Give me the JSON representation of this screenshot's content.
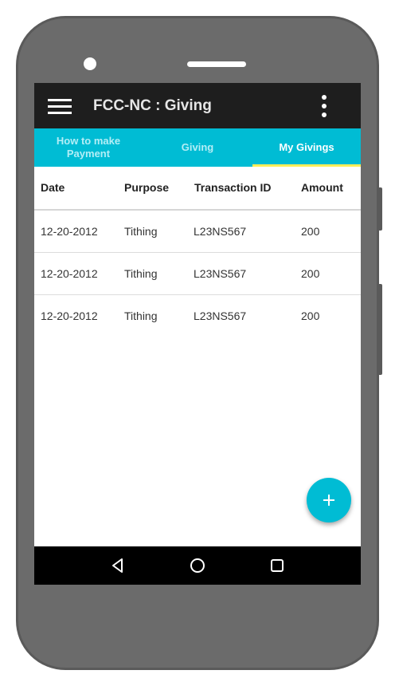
{
  "toolbar": {
    "title": "FCC-NC : Giving",
    "menu_icon": "hamburger-menu-icon",
    "overflow_icon": "more-vert-icon"
  },
  "tabs": [
    {
      "label_line1": "How to make",
      "label_line2": "Payment",
      "active": false
    },
    {
      "label": "Giving",
      "active": false
    },
    {
      "label": "My Givings",
      "active": true
    }
  ],
  "table": {
    "columns": [
      "Date",
      "Purpose",
      "Transaction ID",
      "Amount"
    ],
    "rows": [
      [
        "12-20-2012",
        "Tithing",
        "L23NS567",
        "200"
      ],
      [
        "12-20-2012",
        "Tithing",
        "L23NS567",
        "200"
      ],
      [
        "12-20-2012",
        "Tithing",
        "L23NS567",
        "200"
      ]
    ]
  },
  "fab": {
    "icon": "plus-icon"
  },
  "navbar": {
    "icons": [
      "back-icon",
      "home-icon",
      "recents-icon"
    ]
  },
  "colors": {
    "accent": "#00bcd4",
    "toolbar": "#1e1e1e",
    "tab_indicator": "#ffee58",
    "phone_body": "#6b6b6b"
  }
}
